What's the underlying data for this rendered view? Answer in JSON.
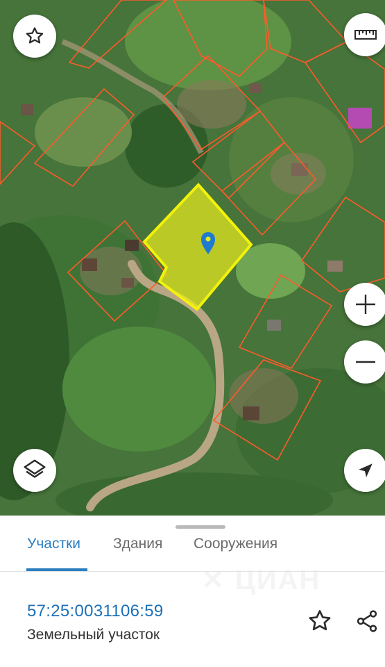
{
  "map": {
    "type": "satellite",
    "parcel_highlight_color": "#f2f20a",
    "boundary_color": "#ff5a2a",
    "buttons": {
      "favorite": "star-outline-icon",
      "ruler": "ruler-icon",
      "zoom_in": "plus-icon",
      "zoom_out": "minus-icon",
      "layers": "layers-icon",
      "locate": "navigation-arrow-icon"
    }
  },
  "tabs": [
    {
      "label": "Участки",
      "active": true
    },
    {
      "label": "Здания",
      "active": false
    },
    {
      "label": "Сооружения",
      "active": false
    }
  ],
  "parcel": {
    "cadastral_number": "57:25:0031106:59",
    "type": "Земельный участок"
  },
  "actions": {
    "favorite": "star-outline-icon",
    "share": "share-icon"
  },
  "colors": {
    "accent": "#2b7ec1",
    "pin": "#1f7bd0"
  }
}
